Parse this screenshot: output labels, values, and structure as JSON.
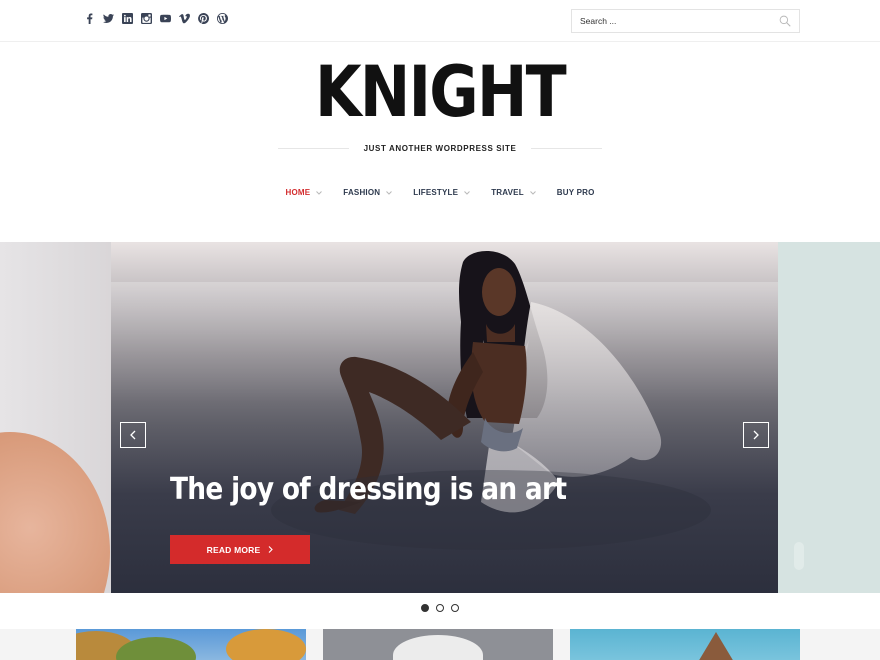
{
  "social": {
    "icons": [
      "facebook-icon",
      "twitter-icon",
      "linkedin-icon",
      "instagram-icon",
      "youtube-icon",
      "vimeo-icon",
      "pinterest-icon",
      "wordpress-icon"
    ]
  },
  "search": {
    "placeholder": "Search ..."
  },
  "site": {
    "title": "KNIGHT",
    "tagline": "JUST ANOTHER WORDPRESS SITE"
  },
  "nav": {
    "items": [
      {
        "label": "HOME",
        "active": true,
        "has_dropdown": true
      },
      {
        "label": "FASHION",
        "active": false,
        "has_dropdown": true
      },
      {
        "label": "LIFESTYLE",
        "active": false,
        "has_dropdown": true
      },
      {
        "label": "TRAVEL",
        "active": false,
        "has_dropdown": true
      },
      {
        "label": "BUY PRO",
        "active": false,
        "has_dropdown": false
      }
    ]
  },
  "slider": {
    "title": "The joy of dressing is an art",
    "button_label": "READ MORE",
    "slide_count": 3,
    "active_index": 0
  },
  "colors": {
    "accent": "#d42b2b",
    "nav_text": "#2e3a4e",
    "nav_active": "#d32d2f"
  }
}
